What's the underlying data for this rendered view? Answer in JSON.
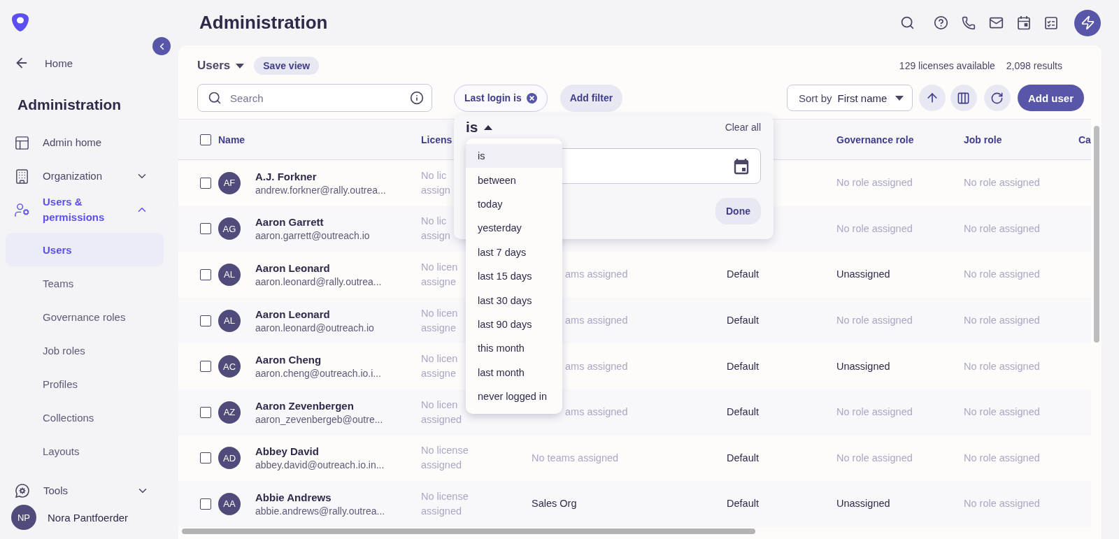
{
  "app": {
    "title": "Administration"
  },
  "sidebar": {
    "back": "Home",
    "title": "Administration",
    "items": [
      {
        "kind": "link",
        "label": "Admin home",
        "selected": false
      },
      {
        "kind": "group",
        "label": "Organization",
        "selected": false,
        "expanded": false
      },
      {
        "kind": "group",
        "label": "Users & permissions",
        "selected": true,
        "expanded": true,
        "children": [
          {
            "label": "Users",
            "selected": true
          },
          {
            "label": "Teams",
            "selected": false
          },
          {
            "label": "Governance roles",
            "selected": false
          },
          {
            "label": "Job roles",
            "selected": false
          },
          {
            "label": "Profiles",
            "selected": false
          },
          {
            "label": "Collections",
            "selected": false
          },
          {
            "label": "Layouts",
            "selected": false
          }
        ]
      },
      {
        "kind": "group",
        "label": "Tools",
        "selected": false,
        "expanded": false
      }
    ],
    "user": {
      "initials": "NP",
      "name": "Nora Pantfoerder"
    }
  },
  "toolbar": {
    "view": "Users",
    "save_view": "Save view",
    "licenses": "129 licenses available",
    "results": "2,098 results",
    "search": {
      "placeholder": "Search"
    },
    "filter_chip": "Last login is",
    "add_filter": "Add filter",
    "sort_label": "Sort by",
    "sort_value": "First name",
    "add_user": "Add user"
  },
  "table": {
    "select_all_checked": false,
    "columns": [
      {
        "kind": "text",
        "label": "Name"
      },
      {
        "kind": "text",
        "label": "Licens"
      },
      {
        "kind": "covered"
      },
      {
        "kind": "covered"
      },
      {
        "kind": "text",
        "label": "Governance role"
      },
      {
        "kind": "text",
        "label": "Job role"
      },
      {
        "kind": "text",
        "label": "Ca"
      }
    ],
    "rows": [
      {
        "checked": false,
        "cells": [
          {
            "kind": "user",
            "initials": "AF",
            "name": "A.J. Forkner",
            "email": "andrew.forkner@rally.outrea..."
          },
          {
            "kind": "muted",
            "lines": [
              "No lic",
              "assign"
            ]
          },
          {
            "kind": "covered"
          },
          {
            "kind": "covered"
          },
          {
            "kind": "muted",
            "lines": [
              "No role assigned"
            ]
          },
          {
            "kind": "muted",
            "lines": [
              "No role assigned"
            ]
          }
        ]
      },
      {
        "checked": false,
        "cells": [
          {
            "kind": "user",
            "initials": "AG",
            "name": "Aaron Garrett",
            "email": "aaron.garrett@outreach.io"
          },
          {
            "kind": "muted",
            "lines": [
              "No lic",
              "assign"
            ]
          },
          {
            "kind": "covered"
          },
          {
            "kind": "covered"
          },
          {
            "kind": "muted",
            "lines": [
              "No role assigned"
            ]
          },
          {
            "kind": "muted",
            "lines": [
              "No role assigned"
            ]
          }
        ]
      },
      {
        "checked": false,
        "cells": [
          {
            "kind": "user",
            "initials": "AL",
            "name": "Aaron Leonard",
            "email": "aaron.leonard@rally.outrea..."
          },
          {
            "kind": "muted",
            "lines": [
              "No licen",
              "assigne"
            ]
          },
          {
            "kind": "cut",
            "lines": [
              "ams assigned"
            ]
          },
          {
            "kind": "plain",
            "lines": [
              "Default"
            ]
          },
          {
            "kind": "plain",
            "lines": [
              "Unassigned"
            ]
          },
          {
            "kind": "muted",
            "lines": [
              "No role assigned"
            ]
          }
        ]
      },
      {
        "checked": false,
        "cells": [
          {
            "kind": "user",
            "initials": "AL",
            "name": "Aaron Leonard",
            "email": "aaron.leonard@outreach.io"
          },
          {
            "kind": "muted",
            "lines": [
              "No licen",
              "assigne"
            ]
          },
          {
            "kind": "cut",
            "lines": [
              "ams assigned"
            ]
          },
          {
            "kind": "plain",
            "lines": [
              "Default"
            ]
          },
          {
            "kind": "muted",
            "lines": [
              "No role assigned"
            ]
          },
          {
            "kind": "muted",
            "lines": [
              "No role assigned"
            ]
          }
        ]
      },
      {
        "checked": false,
        "cells": [
          {
            "kind": "user",
            "initials": "AC",
            "name": "Aaron Cheng",
            "email": "aaron.cheng@outreach.io.i..."
          },
          {
            "kind": "muted",
            "lines": [
              "No licen",
              "assigne"
            ]
          },
          {
            "kind": "cut",
            "lines": [
              "ams assigned"
            ]
          },
          {
            "kind": "plain",
            "lines": [
              "Default"
            ]
          },
          {
            "kind": "plain",
            "lines": [
              "Unassigned"
            ]
          },
          {
            "kind": "muted",
            "lines": [
              "No role assigned"
            ]
          }
        ]
      },
      {
        "checked": false,
        "cells": [
          {
            "kind": "user",
            "initials": "AZ",
            "name": "Aaron Zevenbergen",
            "email": "aaron_zevenbergeb@outre..."
          },
          {
            "kind": "muted",
            "lines": [
              "No licen",
              "assigned"
            ]
          },
          {
            "kind": "cut",
            "lines": [
              "ams assigned"
            ]
          },
          {
            "kind": "plain",
            "lines": [
              "Default"
            ]
          },
          {
            "kind": "muted",
            "lines": [
              "No role assigned"
            ]
          },
          {
            "kind": "muted",
            "lines": [
              "No role assigned"
            ]
          }
        ]
      },
      {
        "checked": false,
        "cells": [
          {
            "kind": "user",
            "initials": "AD",
            "name": "Abbey David",
            "email": "abbey.david@outreach.io.in..."
          },
          {
            "kind": "muted",
            "lines": [
              "No license",
              "assigned"
            ]
          },
          {
            "kind": "muted",
            "lines": [
              "No teams assigned"
            ]
          },
          {
            "kind": "plain",
            "lines": [
              "Default"
            ]
          },
          {
            "kind": "muted",
            "lines": [
              "No role assigned"
            ]
          },
          {
            "kind": "muted",
            "lines": [
              "No role assigned"
            ]
          }
        ]
      },
      {
        "checked": false,
        "cells": [
          {
            "kind": "user",
            "initials": "AA",
            "name": "Abbie Andrews",
            "email": "abbie.andrews@rally.outrea..."
          },
          {
            "kind": "muted",
            "lines": [
              "No license",
              "assigned"
            ]
          },
          {
            "kind": "plain",
            "lines": [
              "Sales Org"
            ]
          },
          {
            "kind": "plain",
            "lines": [
              "Default"
            ]
          },
          {
            "kind": "plain",
            "lines": [
              "Unassigned"
            ]
          },
          {
            "kind": "muted",
            "lines": [
              "No role assigned"
            ]
          }
        ]
      }
    ]
  },
  "filter_popover": {
    "operator": "is",
    "expanded": true,
    "clear_all": "Clear all",
    "done": "Done",
    "options": [
      {
        "label": "is",
        "selected": true
      },
      {
        "label": "between",
        "selected": false
      },
      {
        "label": "today",
        "selected": false
      },
      {
        "label": "yesterday",
        "selected": false
      },
      {
        "label": "last 7 days",
        "selected": false
      },
      {
        "label": "last 15 days",
        "selected": false
      },
      {
        "label": "last 30 days",
        "selected": false
      },
      {
        "label": "last 90 days",
        "selected": false
      },
      {
        "label": "this month",
        "selected": false
      },
      {
        "label": "last month",
        "selected": false
      },
      {
        "label": "never logged in",
        "selected": false
      }
    ]
  }
}
